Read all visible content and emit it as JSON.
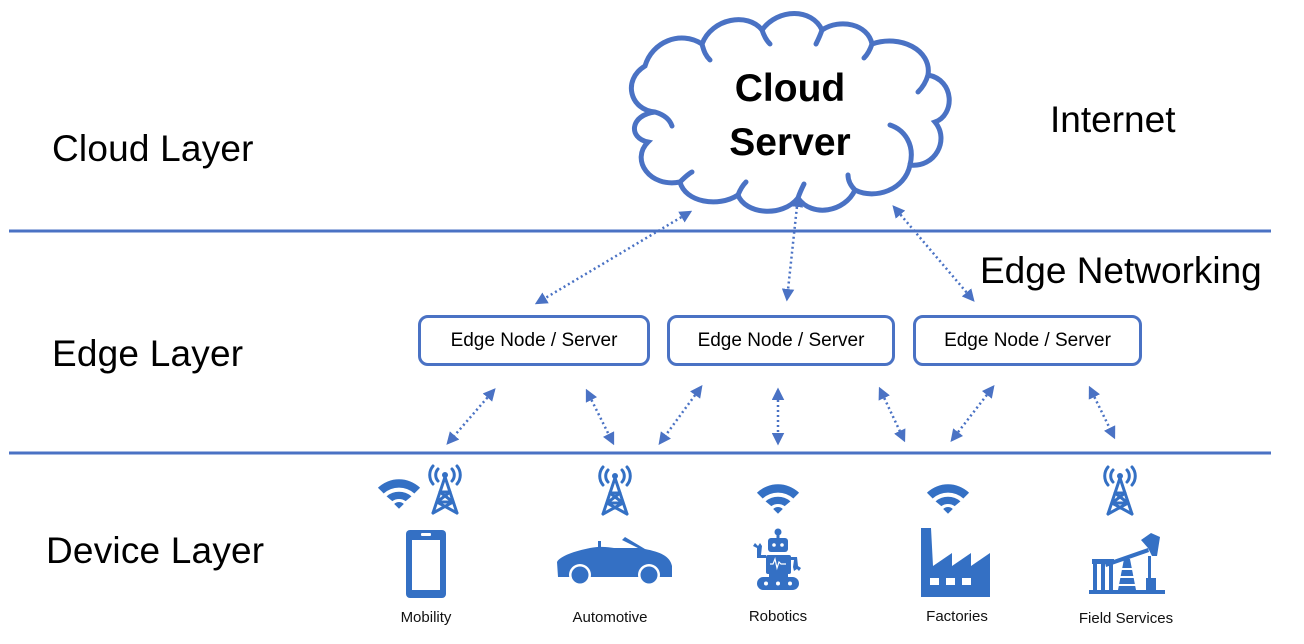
{
  "layers": {
    "cloud": "Cloud Layer",
    "edge": "Edge Layer",
    "device": "Device Layer"
  },
  "zones": {
    "internet": "Internet",
    "edge_networking": "Edge Networking"
  },
  "cloud": {
    "line1": "Cloud",
    "line2": "Server"
  },
  "edge_nodes": [
    {
      "label": "Edge Node / Server"
    },
    {
      "label": "Edge Node / Server"
    },
    {
      "label": "Edge Node / Server"
    }
  ],
  "devices": [
    {
      "label": "Mobility",
      "icon": "smartphone-icon",
      "connectivity": [
        "wifi-icon",
        "cell-tower-icon"
      ]
    },
    {
      "label": "Automotive",
      "icon": "car-icon",
      "connectivity": [
        "cell-tower-icon"
      ]
    },
    {
      "label": "Robotics",
      "icon": "robot-icon",
      "connectivity": [
        "wifi-icon"
      ]
    },
    {
      "label": "Factories",
      "icon": "factory-icon",
      "connectivity": [
        "wifi-icon"
      ]
    },
    {
      "label": "Field Services",
      "icon": "oil-pump-icon",
      "connectivity": [
        "cell-tower-icon"
      ]
    }
  ],
  "connections": {
    "cloud_to_edge": [
      [
        "cloud",
        "edge-node-1"
      ],
      [
        "cloud",
        "edge-node-2"
      ],
      [
        "cloud",
        "edge-node-3"
      ]
    ],
    "edge_to_device": [
      [
        "edge-node-1",
        "Mobility"
      ],
      [
        "edge-node-1",
        "Automotive"
      ],
      [
        "edge-node-2",
        "Automotive"
      ],
      [
        "edge-node-2",
        "Robotics"
      ],
      [
        "edge-node-2",
        "Factories"
      ],
      [
        "edge-node-3",
        "Factories"
      ],
      [
        "edge-node-3",
        "Field Services"
      ]
    ],
    "style": "dotted-bidirectional"
  },
  "colors": {
    "line": "#4a72c4",
    "icon": "#3470c4",
    "text": "#000000"
  }
}
